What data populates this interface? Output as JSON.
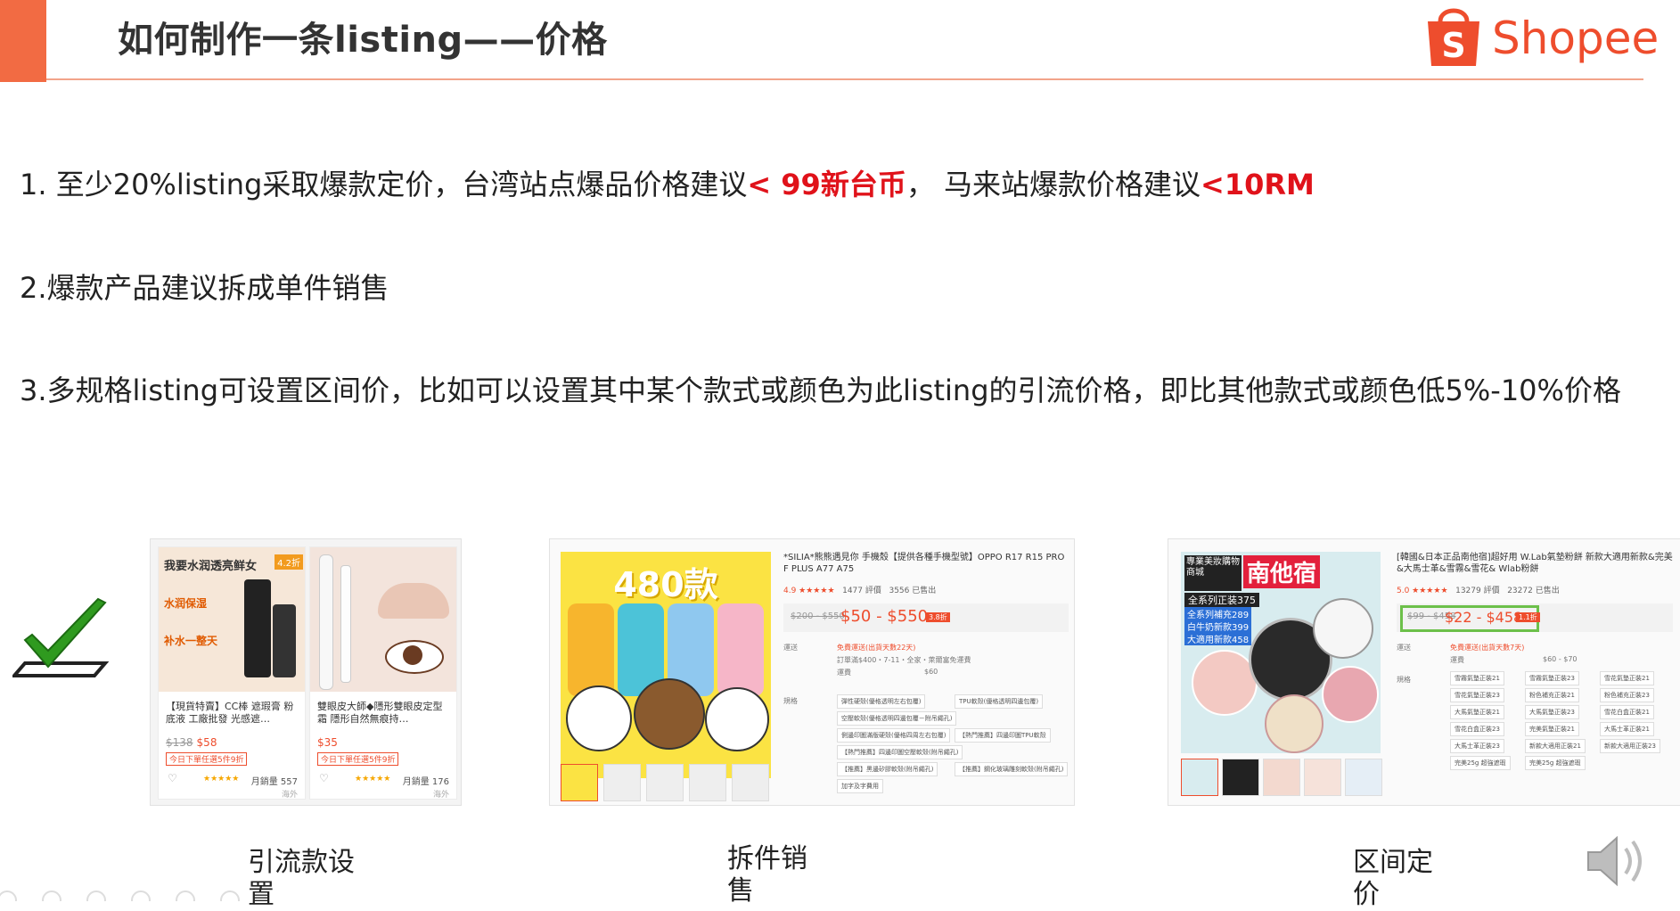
{
  "header": {
    "title": "如何制作一条listing——价格",
    "logo_text": "Shopee",
    "accent_color": "#f26b43",
    "brand_color": "#ee4d2d"
  },
  "points": {
    "p1_a": "1. 至少20%listing采取爆款定价，台湾站点爆品价格建议",
    "p1_hl1": "< 99新台币",
    "p1_b": "， 马来站爆款价格建议",
    "p1_hl2": "<10RM",
    "p2": "2.爆款产品建议拆成单件销售",
    "p3": "3.多规格listing可设置区间价，比如可以设置其中某个款式或颜色为此listing的引流价格，即比其他款式或颜色低5%-10%价格",
    "highlight_color": "#e0121a"
  },
  "icons": {
    "check": "checkmark-icon",
    "speaker": "speaker-icon"
  },
  "example1": {
    "card1": {
      "banner": "我要水润透亮鲜女",
      "discount": "4.2折",
      "tag1": "水润保湿",
      "tag2": "补水一整天",
      "title": "【現貨特賣】CC棒 遮瑕膏 粉底液 工廠批發 光感遮…",
      "old_price": "$138",
      "price": "$58",
      "tag": "今日下單任選5件9折",
      "sold": "月銷量 557",
      "origin": "海外"
    },
    "card2": {
      "title": "雙眼皮大師◆隱形雙眼皮定型霜 隱形自然無痕持…",
      "price": "$35",
      "tag": "今日下單任選5件9折",
      "sold": "月銷量 176",
      "origin": "海外"
    }
  },
  "example2": {
    "banner": "480款",
    "title": "*SILIA*熊熊遇見你 手機殼【提供各種手機型號】OPPO R17 R15 PRO F PLUS A77 A75",
    "rating": "4.9 ★★★★★",
    "reviews": "1477 評價",
    "sold": "3556 已售出",
    "old_price": "$200 - $550",
    "price": "$50 - $550",
    "badge": "3.8折",
    "label_ship": "運送",
    "label_spec": "規格",
    "ship1": "免費運送(出貨天數22天)",
    "ship2": "訂單滿$400・7-11・全家・萊爾富免運費",
    "ship3": "運費",
    "ship3_val": "$60",
    "chips": [
      "彈性硬殼(優格透明左右包覆)",
      "TPU軟殼(優格透明四邊包覆)",
      "空壓軟殼(優格透明四邊包覆－附吊繩孔)",
      "側邊印圖滿版硬殼(優格四周左右包覆)",
      "【熱門推薦】四邊印圖TPU軟殼",
      "【熱門推薦】四邊印圖空壓軟殼(附吊繩孔)",
      "【推薦】黑邊矽膠軟殼(附吊繩孔)",
      "【推薦】鋼化玻璃雕刻軟殼(附吊繩孔)",
      "加字及字費用"
    ]
  },
  "example3": {
    "banner1": "專業美妝購物商城",
    "banner2": "南他宿",
    "banner3": "全系列正装375",
    "banner4": "全系列補充289",
    "banner5": "白牛奶新款399",
    "banner6": "大適用新款458",
    "title": "[韓國&日本正品南他宿]超好用 W.Lab氣墊粉餅 新款大適用新款&完美&大馬士革&雪霧&雪花& Wlab粉餅",
    "rating": "5.0 ★★★★★",
    "reviews": "13279 評價",
    "sold": "23272 已售出",
    "old_price": "$99 - $458",
    "price": "$22 - $458",
    "badge": "1.1折",
    "label_ship": "運送",
    "label_spec": "規格",
    "ship1": "免費運送(出貨天數7天)",
    "ship2": "運費",
    "ship2_val": "$60 - $70",
    "chips": [
      "雪霧氣墊正裝21",
      "雪霧氣墊正裝23",
      "雪花氣墊正裝21",
      "雪花氣墊正裝23",
      "粉色補充正裝21",
      "粉色補充正裝23",
      "大馬氣墊正裝21",
      "大馬氣墊正裝23",
      "雪花白盒正裝21",
      "雪花白盒正裝23",
      "完美氣墊正裝21",
      "大馬士革正裝21",
      "大馬士革正裝23",
      "新款大適用正裝21",
      "新款大適用正裝23",
      "完美25g 超強遮瑕",
      "完美25g 超強遮瑕"
    ]
  },
  "captions": {
    "c1": "引流款设置",
    "c2": "拆件销售",
    "c3": "区间定价"
  }
}
